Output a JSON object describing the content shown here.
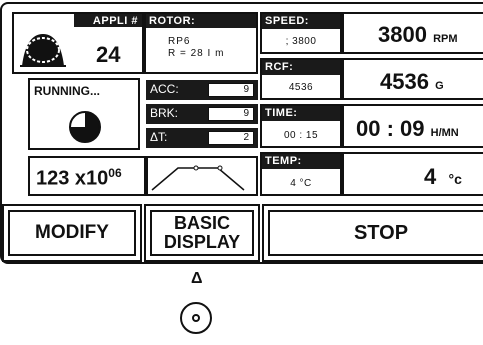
{
  "appli": {
    "label": "APPLI #",
    "number": "24"
  },
  "rotor": {
    "label": "ROTOR:",
    "line1": "RP6",
    "line2": "R = 28 I m"
  },
  "speed": {
    "label": "SPEED:",
    "setpoint": "; 3800",
    "value": "3800",
    "unit": "RPM"
  },
  "rcf": {
    "label": "RCF:",
    "setpoint": "4536",
    "value": "4536",
    "unit": "G"
  },
  "time": {
    "label": "TIME:",
    "setpoint": "00 : 15",
    "value": "00 : 09",
    "unit": "H/MN"
  },
  "temp": {
    "label": "TEMP:",
    "setpoint": "4 °C",
    "value": "4",
    "unit": "°c"
  },
  "status": {
    "label": "RUNNING...",
    "progress_fraction": 0.25
  },
  "acc": {
    "label": "ACC:",
    "value": "9"
  },
  "brk": {
    "label": "BRK:",
    "value": "9"
  },
  "dt": {
    "label": "ΔT:",
    "value": "2"
  },
  "counter": {
    "base": "123 x10",
    "exponent": "06"
  },
  "buttons": {
    "modify": "MODIFY",
    "basic": "BASIC",
    "display": "DISPLAY",
    "stop": "STOP"
  },
  "indicator": {
    "marker": "Δ"
  }
}
